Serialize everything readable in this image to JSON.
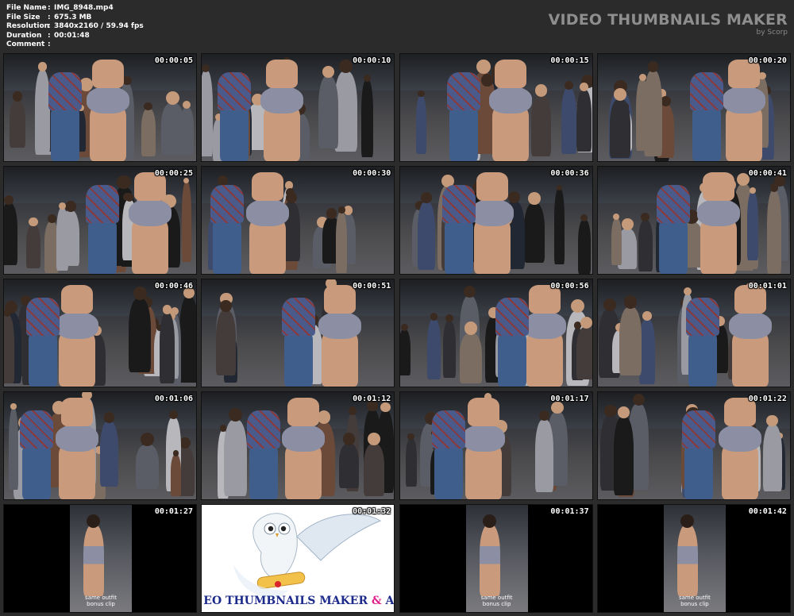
{
  "meta": {
    "rows": [
      {
        "key": "File Name",
        "value": "IMG_8948.mp4"
      },
      {
        "key": "File Size",
        "value": "675.3 MB"
      },
      {
        "key": "Resolution",
        "value": "3840x2160 / 59.94 fps"
      },
      {
        "key": "Duration",
        "value": "00:01:48"
      },
      {
        "key": "Comment",
        "value": ""
      }
    ]
  },
  "brand": {
    "title": "VIDEO THUMBNAILS MAKER",
    "subtitle": "by Scorp"
  },
  "thumbnails": [
    {
      "time": "00:00:05",
      "kind": "crowd"
    },
    {
      "time": "00:00:10",
      "kind": "crowd"
    },
    {
      "time": "00:00:15",
      "kind": "crowd"
    },
    {
      "time": "00:00:20",
      "kind": "crowd"
    },
    {
      "time": "00:00:25",
      "kind": "crowd"
    },
    {
      "time": "00:00:30",
      "kind": "crowd"
    },
    {
      "time": "00:00:36",
      "kind": "crowd"
    },
    {
      "time": "00:00:41",
      "kind": "crowd"
    },
    {
      "time": "00:00:46",
      "kind": "crowd"
    },
    {
      "time": "00:00:51",
      "kind": "crowd"
    },
    {
      "time": "00:00:56",
      "kind": "crowd"
    },
    {
      "time": "00:01:01",
      "kind": "crowd"
    },
    {
      "time": "00:01:06",
      "kind": "crowd"
    },
    {
      "time": "00:01:12",
      "kind": "crowd"
    },
    {
      "time": "00:01:17",
      "kind": "crowd"
    },
    {
      "time": "00:01:22",
      "kind": "crowd"
    },
    {
      "time": "00:01:27",
      "kind": "portrait",
      "note": "same outfit\nbonus clip"
    },
    {
      "time": "00:01:32",
      "kind": "logo",
      "logo_text_a": "EO THUMBNAILS MAKER ",
      "logo_amp": "&",
      "logo_text_b": " ANIMA"
    },
    {
      "time": "00:01:37",
      "kind": "portrait",
      "note": "same outfit\nbonus clip"
    },
    {
      "time": "00:01:42",
      "kind": "portrait",
      "note": "same outfit\nbonus clip"
    }
  ],
  "colors": {
    "background": "#2b2b2b",
    "ceiling": "#1d1f22",
    "floor": "#4a4a4c",
    "shorts": "#8c8fa3",
    "skin": "#c99a7c",
    "plaid": "#4a5a8a",
    "denim": "#3f5e8c"
  }
}
